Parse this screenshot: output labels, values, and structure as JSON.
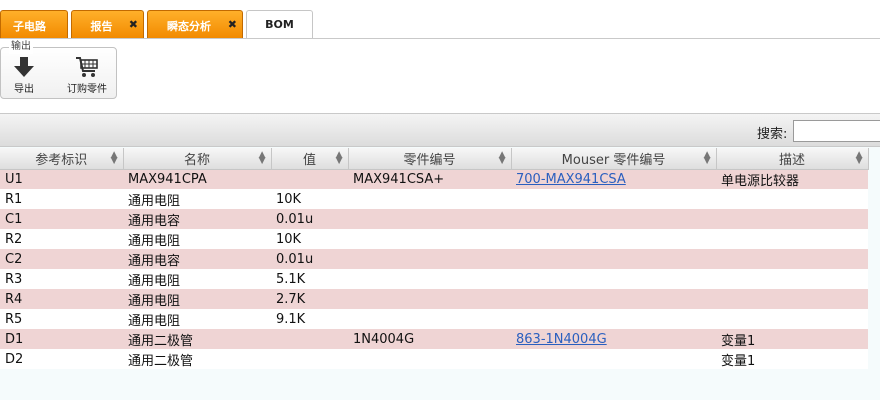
{
  "tabs": [
    {
      "label": "子电路",
      "closable": false
    },
    {
      "label": "报告",
      "closable": true
    },
    {
      "label": "瞬态分析",
      "closable": true
    },
    {
      "label": "BOM",
      "closable": false,
      "active": true
    }
  ],
  "close_glyph": "✖",
  "toolbar": {
    "group_title": "输出",
    "export_label": "导出",
    "order_label": "订购零件"
  },
  "search": {
    "label": "搜索:",
    "value": "",
    "placeholder": ""
  },
  "table": {
    "columns": [
      "参考标识",
      "名称",
      "值",
      "零件编号",
      "Mouser 零件编号",
      "描述"
    ],
    "rows": [
      {
        "ref": "U1",
        "name": "MAX941CPA",
        "value": "",
        "part": "MAX941CSA+",
        "mouser": "700-MAX941CSA",
        "desc": "单电源比较器"
      },
      {
        "ref": "R1",
        "name": "通用电阻",
        "value": "10K",
        "part": "",
        "mouser": "",
        "desc": ""
      },
      {
        "ref": "C1",
        "name": "通用电容",
        "value": "0.01u",
        "part": "",
        "mouser": "",
        "desc": ""
      },
      {
        "ref": "R2",
        "name": "通用电阻",
        "value": "10K",
        "part": "",
        "mouser": "",
        "desc": ""
      },
      {
        "ref": "C2",
        "name": "通用电容",
        "value": "0.01u",
        "part": "",
        "mouser": "",
        "desc": ""
      },
      {
        "ref": "R3",
        "name": "通用电阻",
        "value": "5.1K",
        "part": "",
        "mouser": "",
        "desc": ""
      },
      {
        "ref": "R4",
        "name": "通用电阻",
        "value": "2.7K",
        "part": "",
        "mouser": "",
        "desc": ""
      },
      {
        "ref": "R5",
        "name": "通用电阻",
        "value": "9.1K",
        "part": "",
        "mouser": "",
        "desc": ""
      },
      {
        "ref": "D1",
        "name": "通用二极管",
        "value": "",
        "part": "1N4004G",
        "mouser": "863-1N4004G",
        "desc": "变量1"
      },
      {
        "ref": "D2",
        "name": "通用二极管",
        "value": "",
        "part": "",
        "mouser": "",
        "desc": "变量1"
      }
    ]
  },
  "colors": {
    "tab_orange": "#f28a00",
    "row_alt": "#efd4d4",
    "link": "#2a5fbf"
  },
  "icons": {
    "export": "download-arrow-icon",
    "order": "shopping-cart-icon",
    "sort": "sort-arrows-icon"
  }
}
